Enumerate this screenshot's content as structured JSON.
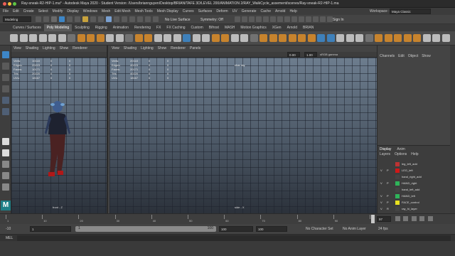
{
  "window": {
    "title": "Ray-sneak-R2-HIP-1.ma* - Autodesk Maya 2020 - Student Version: /Users/briannguyen/Desktop/BRIAN/TAFE 3D/LEVEL 200/ANIMATION 2/RAY_WalkCycle_assement/scenes/Ray-sneak-R2-HIP-1.ma"
  },
  "menubar": {
    "items": [
      "File",
      "Edit",
      "Create",
      "Select",
      "Modify",
      "Display",
      "Windows",
      "Mesh",
      "Edit Mesh",
      "Mesh Tools",
      "Mesh Display",
      "Curves",
      "Surfaces",
      "Deform",
      "UV",
      "Generate",
      "Cache",
      "Arnold",
      "Help"
    ],
    "workspace_label": "Workspace :",
    "workspace_value": "Maya Classic"
  },
  "statusline": {
    "mode": "Modeling",
    "live_surface": "No Live Surface",
    "symmetry": "Symmetry: Off",
    "sign_in": "Sign In"
  },
  "shelf": {
    "tabs": [
      "Curves / Surfaces",
      "Poly Modeling",
      "Sculpting",
      "Rigging",
      "Animation",
      "Rendering",
      "FX",
      "FX Caching",
      "Custom",
      "Bifrost",
      "MASH",
      "Motion Graphics",
      "XGen",
      "Arnold",
      "BRIAN"
    ],
    "active_tab": "Poly Modeling"
  },
  "panel_menus": [
    "View",
    "Shading",
    "Lighting",
    "Show",
    "Renderer"
  ],
  "panel_right_menus": [
    "View",
    "Shading",
    "Lighting",
    "Show",
    "Renderer",
    "Panels"
  ],
  "right_panel_tabs": [
    "Channels",
    "Edit",
    "Object",
    "Show"
  ],
  "hud": {
    "rows": [
      {
        "label": "Verts:",
        "v1": "10118",
        "v2": "0",
        "v3": "0"
      },
      {
        "label": "Edges:",
        "v1": "20223",
        "v2": "0",
        "v3": "0"
      },
      {
        "label": "Faces:",
        "v1": "10171",
        "v2": "0",
        "v3": "0"
      },
      {
        "label": "Tris:",
        "v1": "20220",
        "v2": "0",
        "v3": "0"
      },
      {
        "label": "UVs:",
        "v1": "18167",
        "v2": "0",
        "v3": "0"
      }
    ],
    "right_rows": [
      {
        "label": "Verts:",
        "v1": "20118",
        "v2": "0",
        "v3": "0"
      },
      {
        "label": "Edges:",
        "v1": "40223",
        "v2": "0",
        "v3": "0"
      },
      {
        "label": "Faces:",
        "v1": "20171",
        "v2": "0",
        "v3": "0"
      },
      {
        "label": "Tris:",
        "v1": "40220",
        "v2": "0",
        "v3": "0"
      },
      {
        "label": "UVs:",
        "v1": "18167",
        "v2": "0",
        "v3": "0"
      }
    ],
    "extra": "char  ray"
  },
  "cams": {
    "left": "front - Z",
    "right": "side - X"
  },
  "toolbar_fields": {
    "near": "0.00",
    "far": "1.00",
    "gamma": "sRGB gamma"
  },
  "layer_editor": {
    "tabs": [
      "Display",
      "Anim"
    ],
    "menu": [
      "Layers",
      "Options",
      "Help"
    ],
    "layers": [
      {
        "v": "",
        "p": "",
        "name": "leg_left_add",
        "color": "#b33"
      },
      {
        "v": "V",
        "p": "P",
        "name": "LEG_left",
        "color": "#d01818"
      },
      {
        "v": "",
        "p": "",
        "name": "hand_right_add",
        "color": "#444"
      },
      {
        "v": "V",
        "p": "P",
        "name": "HAND_right",
        "color": "#2fb45a"
      },
      {
        "v": "",
        "p": "",
        "name": "hand_left_add",
        "color": "#444"
      },
      {
        "v": "V",
        "p": "P",
        "name": "HAND_left",
        "color": "#2fb45a"
      },
      {
        "v": "V",
        "p": "P",
        "name": "FACE_control",
        "color": "#e8e020"
      },
      {
        "v": "V",
        "p": "R",
        "name": "ray_hi_layer",
        "color": "#444"
      }
    ]
  },
  "timeline": {
    "ticks": [
      "1",
      "10",
      "20",
      "30",
      "40",
      "50",
      "60",
      "70",
      "80",
      "90",
      "97"
    ],
    "current_frame": "97",
    "start": "-10",
    "range_start": "1",
    "range_field": "1",
    "range_end": "100",
    "end1": "100",
    "end2": "100",
    "character_set": "No Character Set",
    "anim_layer": "No Anim Layer",
    "fps": "24 fps"
  },
  "cmdline": {
    "label": "MEL"
  }
}
